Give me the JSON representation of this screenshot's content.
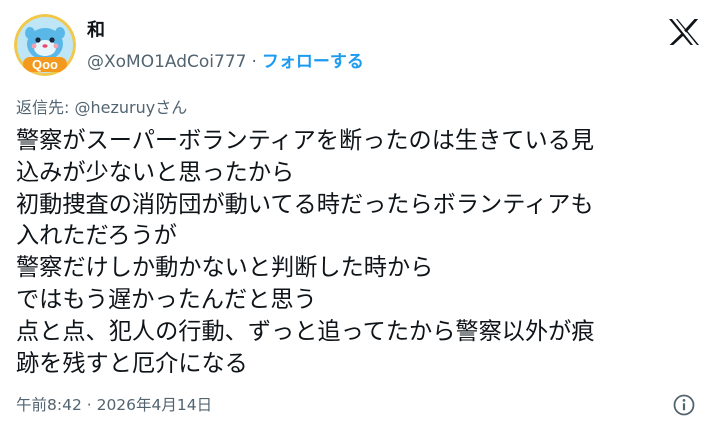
{
  "author": {
    "display_name": "和",
    "handle": "@XoMO1AdCoi777",
    "separator": "·",
    "follow_label": "フォローする",
    "avatar_text": "Qoo"
  },
  "reply": {
    "prefix": "返信先: ",
    "to_handle": "@hezuruy",
    "suffix": "さん"
  },
  "tweet": {
    "lines": [
      "警察がスーパーボランティアを断ったのは生きている見",
      "込みが少ないと思ったから",
      "初動捜査の消防団が動いてる時だったらボランティアも",
      "入れただろうが",
      "警察だけしか動かないと判断した時から",
      "ではもう遅かったんだと思う",
      "点と点、犯人の行動、ずっと追ってたから警察以外が痕",
      "跡を残すと厄介になる"
    ]
  },
  "meta": {
    "timestamp": "午前8:42 · 2026年4月14日"
  },
  "colors": {
    "text": "#0f1419",
    "secondary": "#536471",
    "link": "#1d9bf0"
  },
  "icons": {
    "brand": "x-logo-icon",
    "info": "info-icon"
  }
}
